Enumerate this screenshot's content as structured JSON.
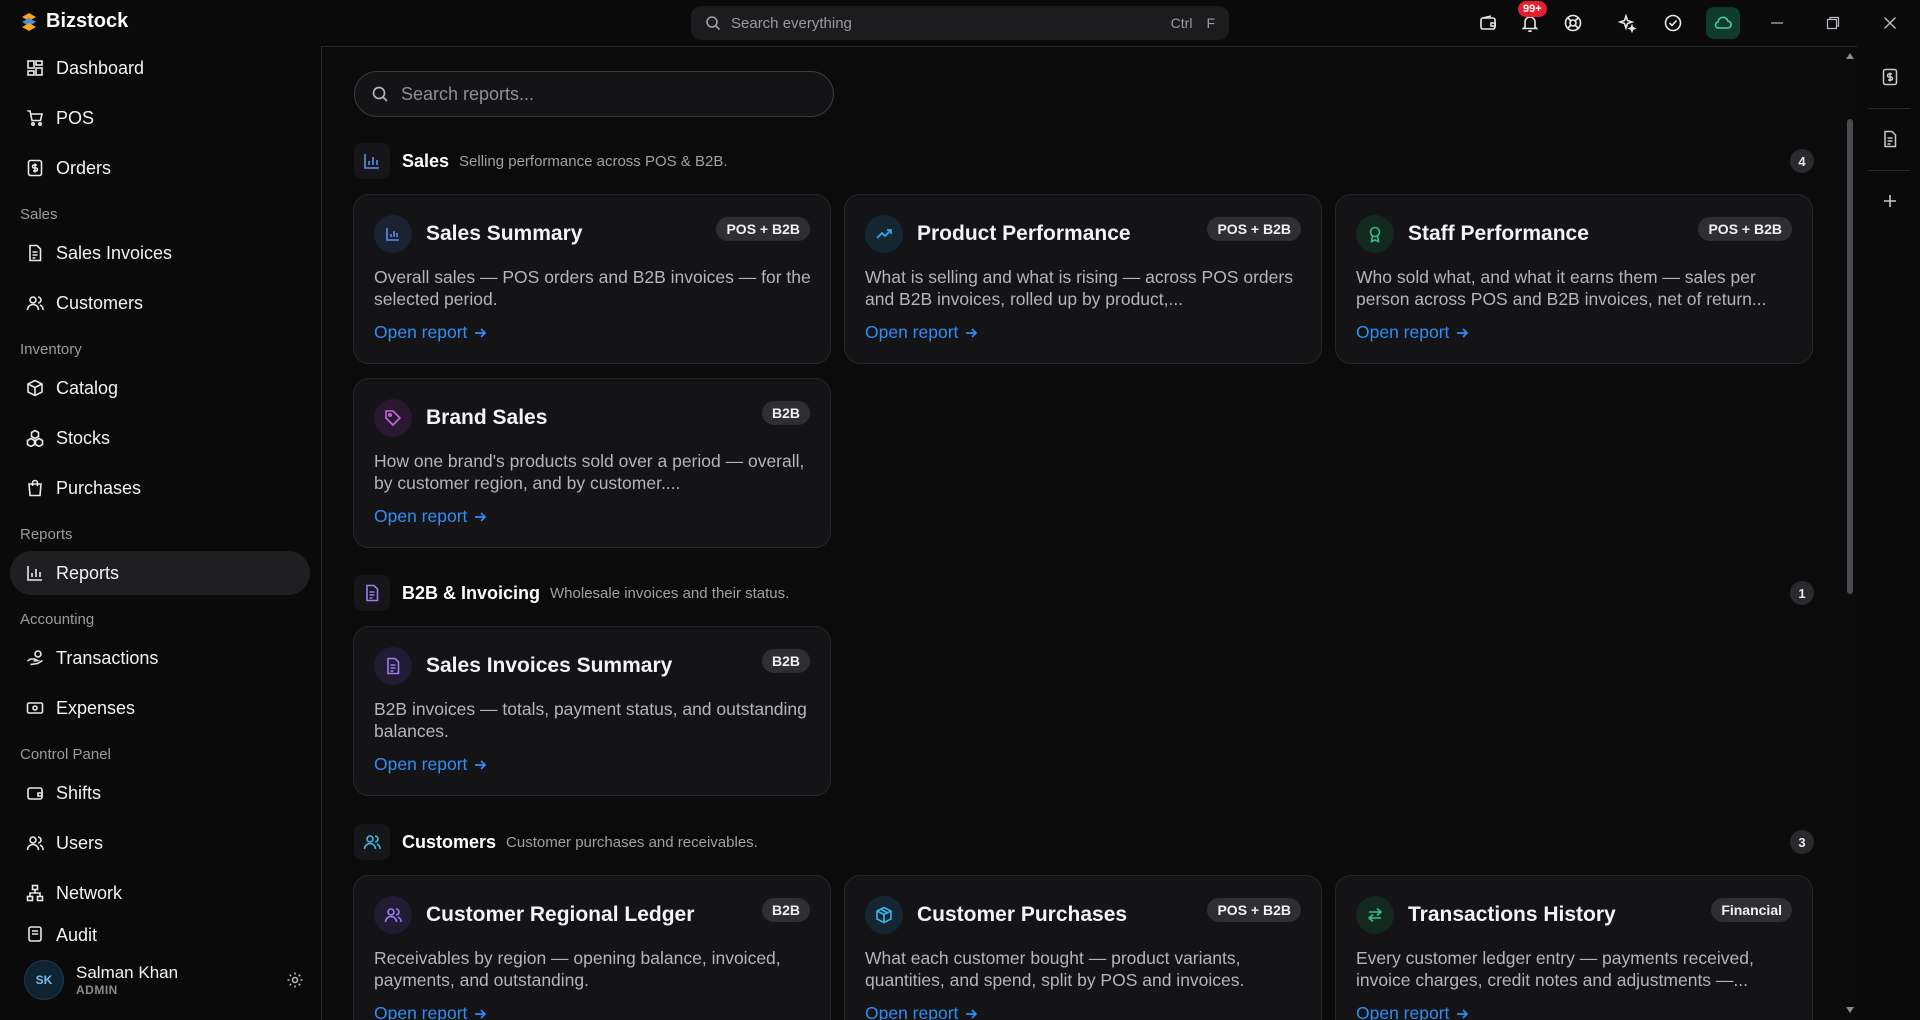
{
  "app": {
    "name": "Bizstock"
  },
  "search": {
    "placeholder": "Search everything",
    "shortcut_ctrl": "Ctrl",
    "shortcut_key": "F"
  },
  "notifications": {
    "badge": "99+"
  },
  "sidebar": {
    "items": [
      {
        "label": "Dashboard",
        "icon": "dashboard-icon"
      },
      {
        "label": "POS",
        "icon": "cart-icon"
      },
      {
        "label": "Orders",
        "icon": "dollar-doc-icon"
      }
    ],
    "groups": [
      {
        "label": "Sales",
        "items": [
          {
            "label": "Sales Invoices",
            "icon": "document-icon"
          },
          {
            "label": "Customers",
            "icon": "users-icon"
          }
        ]
      },
      {
        "label": "Inventory",
        "items": [
          {
            "label": "Catalog",
            "icon": "box-icon"
          },
          {
            "label": "Stocks",
            "icon": "boxes-icon"
          },
          {
            "label": "Purchases",
            "icon": "bag-icon"
          }
        ]
      },
      {
        "label": "Reports",
        "items": [
          {
            "label": "Reports",
            "icon": "bar-chart-icon",
            "active": true
          }
        ]
      },
      {
        "label": "Accounting",
        "items": [
          {
            "label": "Transactions",
            "icon": "hand-coins-icon"
          },
          {
            "label": "Expenses",
            "icon": "banknote-icon"
          }
        ]
      },
      {
        "label": "Control Panel",
        "items": [
          {
            "label": "Shifts",
            "icon": "wallet-icon"
          },
          {
            "label": "Users",
            "icon": "users-icon"
          },
          {
            "label": "Network",
            "icon": "network-icon"
          },
          {
            "label": "Audit",
            "icon": "audit-icon"
          }
        ]
      }
    ],
    "user": {
      "initials": "SK",
      "name": "Salman Khan",
      "role": "ADMIN"
    }
  },
  "reports": {
    "search_placeholder": "Search reports...",
    "sections": [
      {
        "title": "Sales",
        "subtitle": "Selling performance across POS & B2B.",
        "count": "4",
        "cards": [
          {
            "title": "Sales Summary",
            "badge": "POS + B2B",
            "desc": "Overall sales — POS orders and B2B invoices — for the selected period.",
            "link": "Open report",
            "icon": "bar-chart-icon",
            "color": "#5b8def"
          },
          {
            "title": "Product Performance",
            "badge": "POS + B2B",
            "desc": "What is selling and what is rising — across POS orders and B2B invoices, rolled up by product,...",
            "link": "Open report",
            "icon": "trending-up-icon",
            "color": "#38a8e8"
          },
          {
            "title": "Staff Performance",
            "badge": "POS + B2B",
            "desc": "Who sold what, and what it earns them — sales per person across POS and B2B invoices, net of return...",
            "link": "Open report",
            "icon": "award-icon",
            "color": "#2fc08a"
          },
          {
            "title": "Brand Sales",
            "badge": "B2B",
            "desc": "How one brand's products sold over a period — overall, by customer region, and by customer....",
            "link": "Open report",
            "icon": "tag-icon",
            "color": "#c86ad8"
          }
        ]
      },
      {
        "title": "B2B & Invoicing",
        "subtitle": "Wholesale invoices and their status.",
        "count": "1",
        "cards": [
          {
            "title": "Sales Invoices Summary",
            "badge": "B2B",
            "desc": "B2B invoices — totals, payment status, and outstanding balances.",
            "link": "Open report",
            "icon": "document-icon",
            "color": "#9b7cf0"
          }
        ]
      },
      {
        "title": "Customers",
        "subtitle": "Customer purchases and receivables.",
        "count": "3",
        "cards": [
          {
            "title": "Customer Regional Ledger",
            "badge": "B2B",
            "desc": "Receivables by region — opening balance, invoiced, payments, and outstanding.",
            "link": "Open report",
            "icon": "users-icon",
            "color": "#9b7cf0"
          },
          {
            "title": "Customer Purchases",
            "badge": "POS + B2B",
            "desc": "What each customer bought — product variants, quantities, and spend, split by POS and invoices.",
            "link": "Open report",
            "icon": "package-icon",
            "color": "#38b8e8"
          },
          {
            "title": "Transactions History",
            "badge": "Financial",
            "desc": "Every customer ledger entry — payments received, invoice charges, credit notes and adjustments —...",
            "link": "Open report",
            "icon": "arrows-icon",
            "color": "#2fc08a"
          }
        ]
      }
    ]
  }
}
